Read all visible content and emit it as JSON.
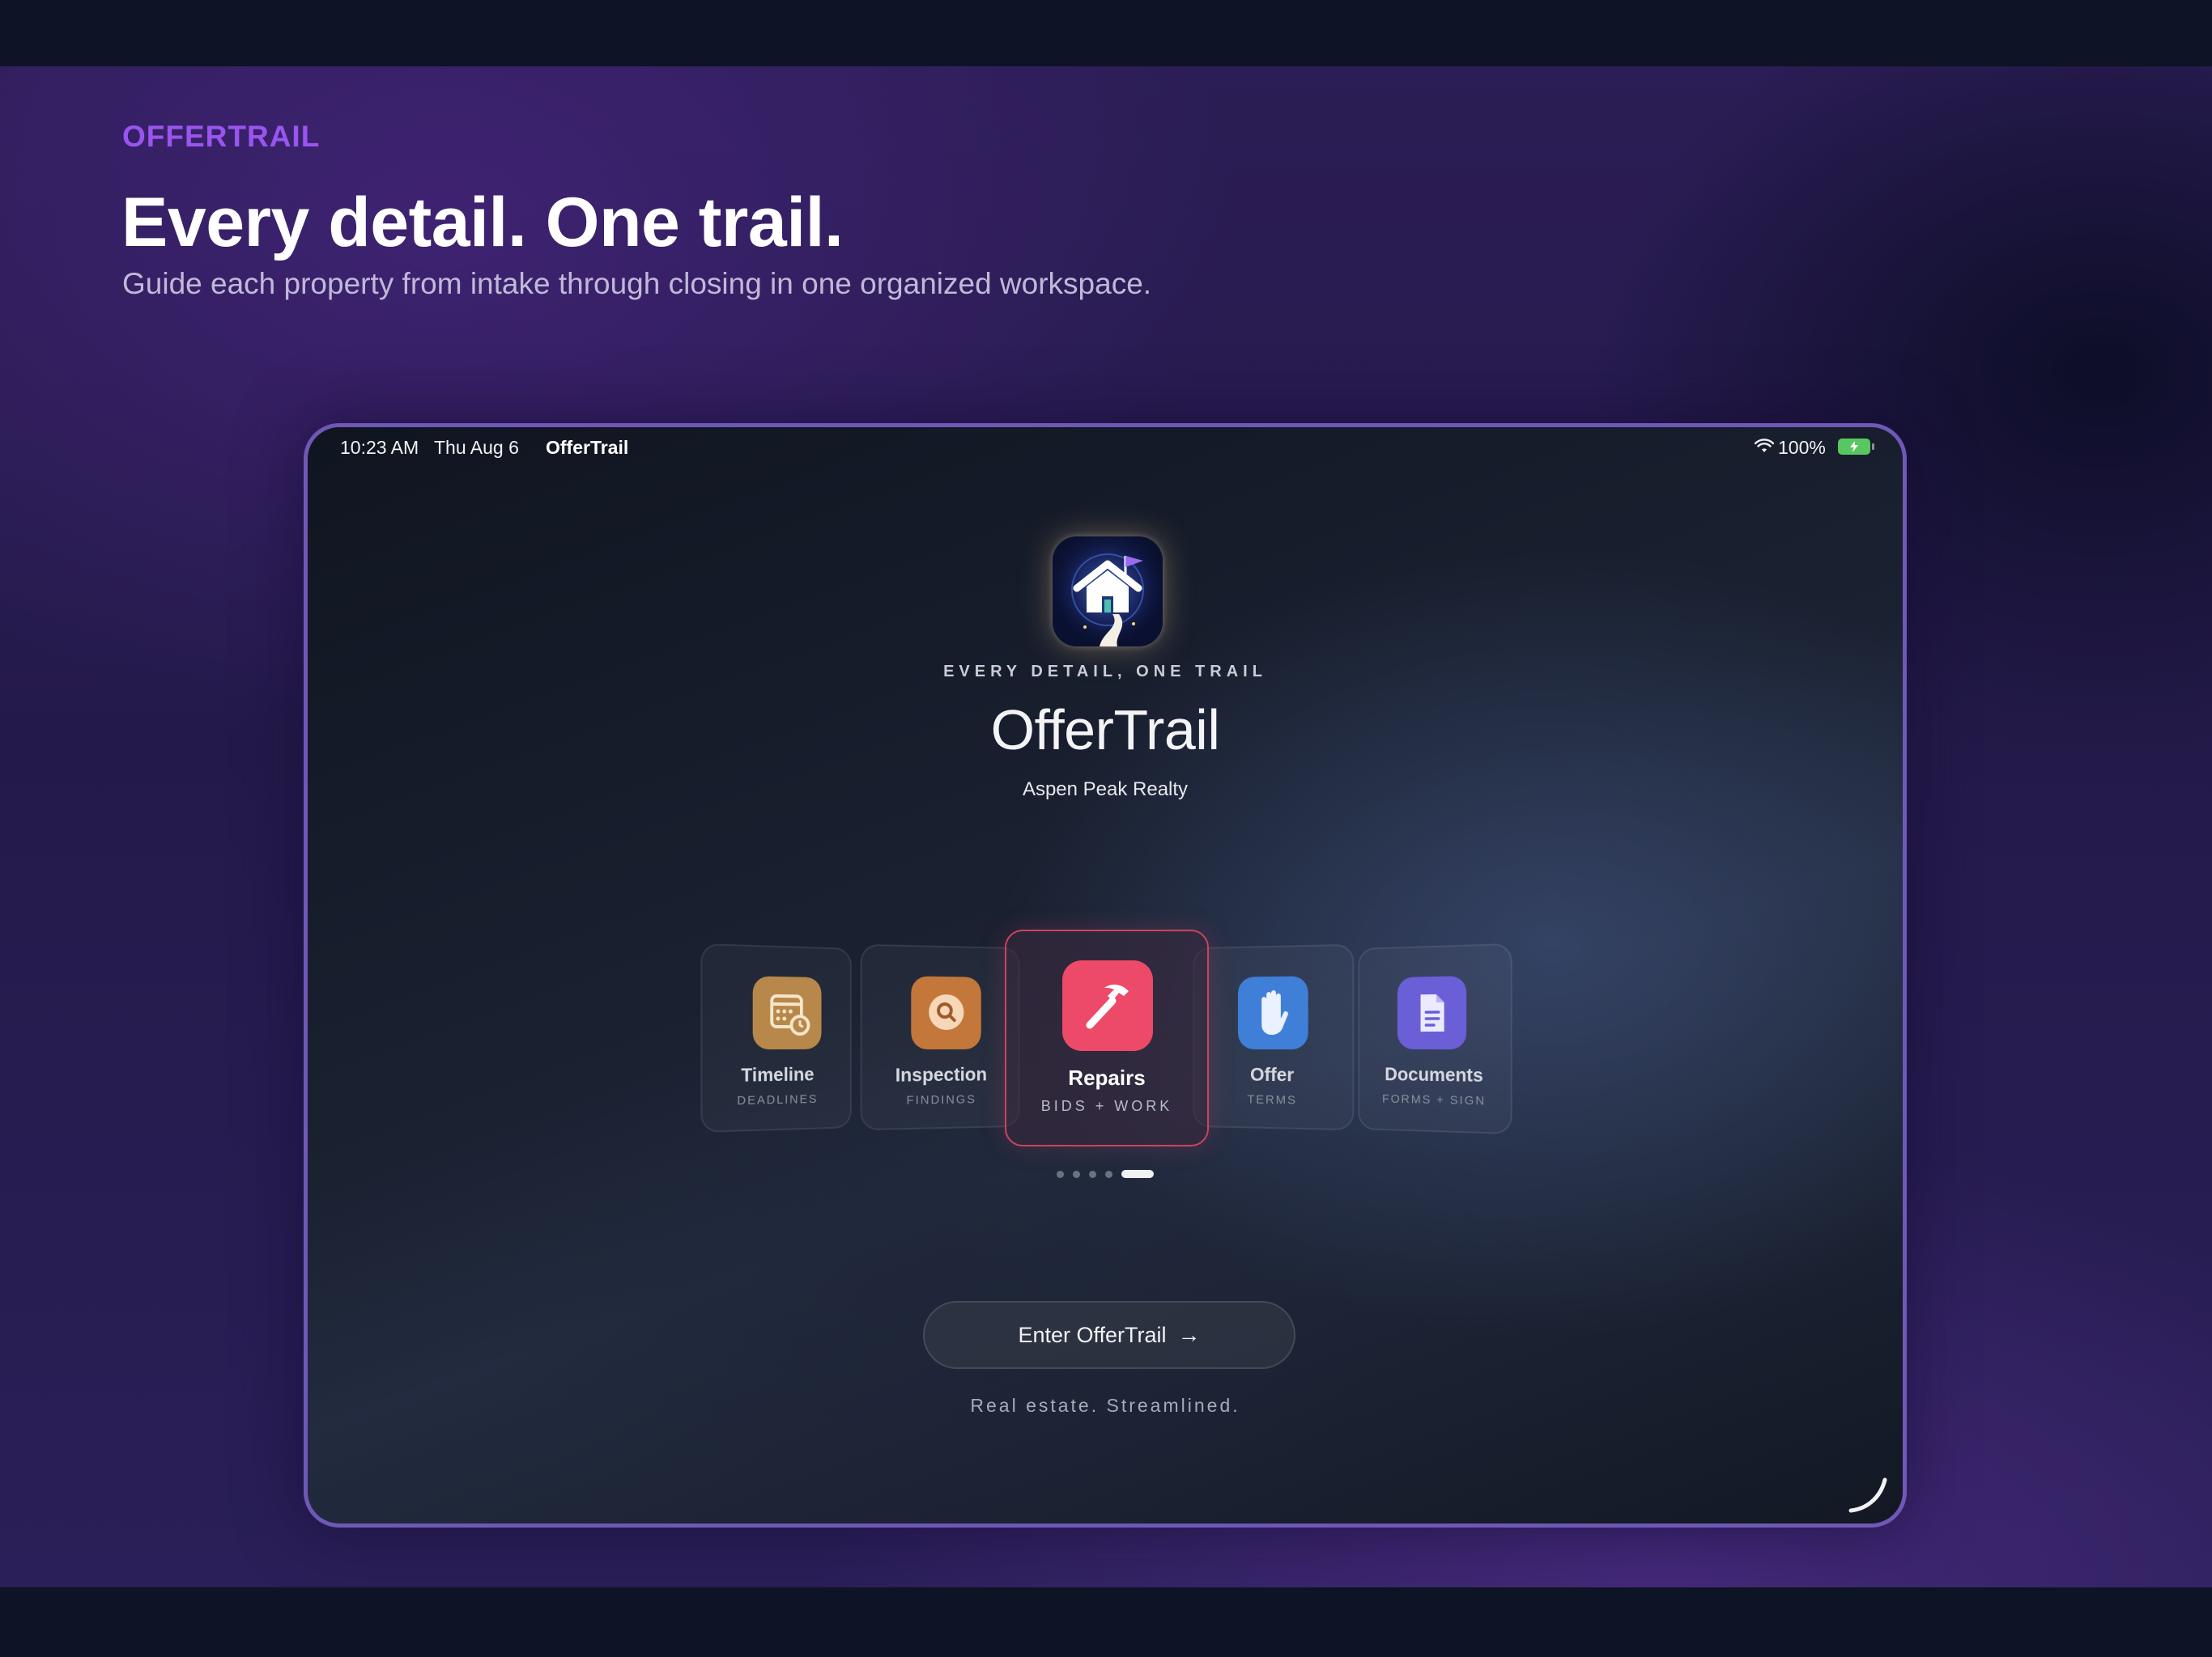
{
  "page": {
    "brand_label": "OFFERTRAIL",
    "headline": "Every detail. One trail.",
    "subhead": "Guide each property from intake through closing in one organized workspace."
  },
  "status_bar": {
    "time": "10:23 AM",
    "date": "Thu Aug 6",
    "app": "OfferTrail",
    "battery": "100%"
  },
  "splash": {
    "tagline": "EVERY DETAIL, ONE TRAIL",
    "title": "OfferTrail",
    "company": "Aspen Peak Realty",
    "app_icon": "house-trail-flag-icon"
  },
  "cards": [
    {
      "label": "Timeline",
      "sub": "DEADLINES",
      "icon": "calendar-icon",
      "color": "#b8884a"
    },
    {
      "label": "Inspection",
      "sub": "FINDINGS",
      "icon": "magnifier-icon",
      "color": "#c4773a"
    },
    {
      "label": "Repairs",
      "sub": "BIDS + WORK",
      "icon": "hammer-icon",
      "color": "#ec4a68"
    },
    {
      "label": "Offer",
      "sub": "TERMS",
      "icon": "hand-icon",
      "color": "#3f7fd8"
    },
    {
      "label": "Documents",
      "sub": "FORMS + SIGN",
      "icon": "document-icon",
      "color": "#6a5fd6"
    }
  ],
  "pager": {
    "count": 5,
    "active": 5
  },
  "cta": {
    "label": "Enter OfferTrail",
    "icon": "arrow-right-icon"
  },
  "footer": "Real estate. Streamlined.",
  "colors": {
    "brand_purple": "#9a55f0",
    "device_border": "#6e58b8",
    "active_card_border": "#c8455d",
    "battery": "#59c761"
  }
}
